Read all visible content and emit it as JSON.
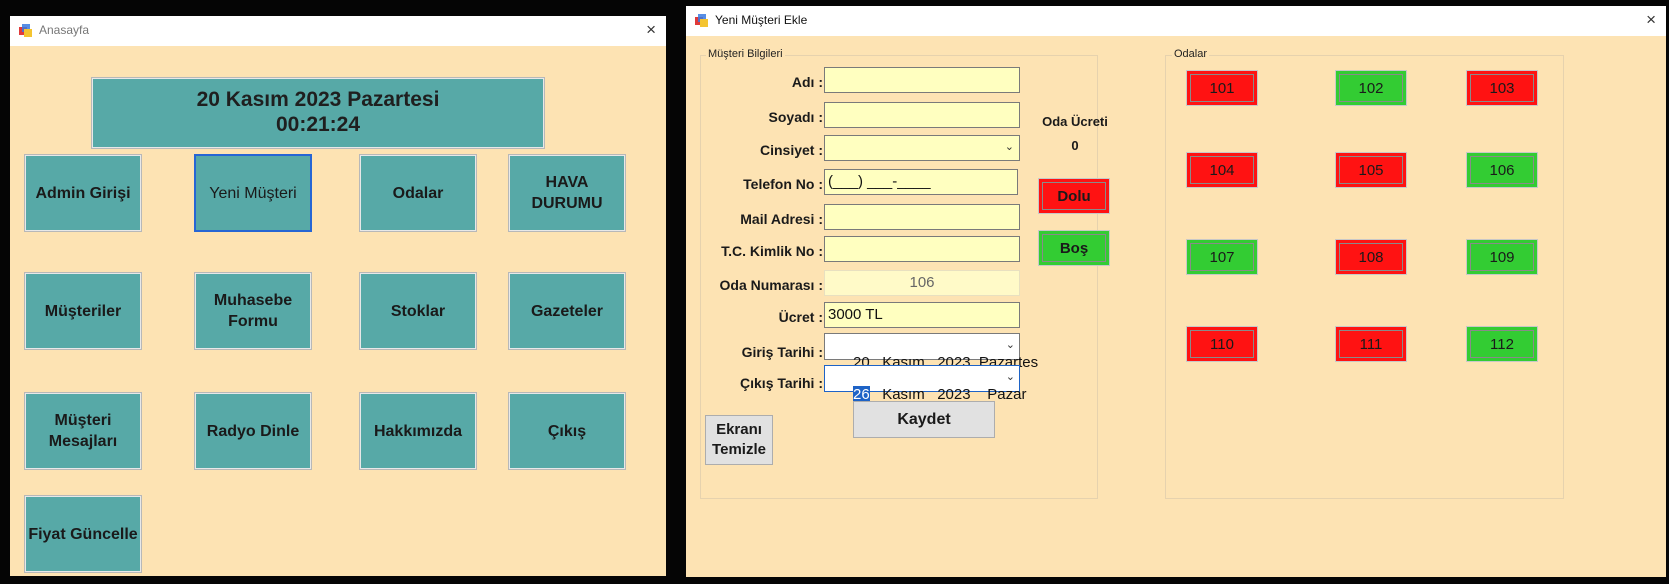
{
  "colors": {
    "background": "#fde3b3",
    "teal_button": "#57a9a7",
    "occupied": "#ff1212",
    "vacant": "#33cc33",
    "input_bg": "#ffffc0",
    "selection": "#1e63c6"
  },
  "main_window": {
    "title": "Anasayfa",
    "icon": "app-icon",
    "close_icon": "×",
    "date_line": "20 Kasım 2023 Pazartesi",
    "time_line": "00:21:24",
    "buttons": [
      "Admin Girişi",
      "Yeni Müşteri",
      "Odalar",
      "HAVA DURUMU",
      "Müşteriler",
      "Muhasebe Formu",
      "Stoklar",
      "Gazeteler",
      "Müşteri Mesajları",
      "Radyo Dinle",
      "Hakkımızda",
      "Çıkış",
      "Fiyat Güncelle"
    ]
  },
  "customer_window": {
    "title": "Yeni Müşteri Ekle",
    "icon": "app-icon",
    "close_icon": "×",
    "customer_group": {
      "title": "Müşteri Bilgileri",
      "fields": {
        "name": {
          "label": "Adı :",
          "value": ""
        },
        "surname": {
          "label": "Soyadı :",
          "value": ""
        },
        "gender": {
          "label": "Cinsiyet :",
          "value": ""
        },
        "phone": {
          "label": "Telefon No :",
          "value": "(___) ___-____"
        },
        "mail": {
          "label": "Mail Adresi :",
          "value": ""
        },
        "tc": {
          "label": "T.C. Kimlik No :",
          "value": ""
        },
        "room_no": {
          "label": "Oda Numarası :",
          "value": "106"
        },
        "price": {
          "label": "Ücret :",
          "value": "3000 TL"
        },
        "checkin": {
          "label": "Giriş Tarihi :",
          "value": "20   Kasım   2023  Pazartes"
        },
        "checkout": {
          "label": "Çıkış Tarihi :",
          "day": "26",
          "rest": "   Kasım   2023    Pazar"
        }
      },
      "save_button": "Kaydet",
      "clear_button": "Ekranı Temizle"
    },
    "room_fee": {
      "label": "Oda Ücreti",
      "value": "0"
    },
    "legend": {
      "occupied": "Dolu",
      "vacant": "Boş"
    },
    "rooms_group": {
      "title": "Odalar",
      "rooms": [
        {
          "number": "101",
          "status": "occupied"
        },
        {
          "number": "102",
          "status": "vacant"
        },
        {
          "number": "103",
          "status": "occupied"
        },
        {
          "number": "104",
          "status": "occupied"
        },
        {
          "number": "105",
          "status": "occupied"
        },
        {
          "number": "106",
          "status": "vacant"
        },
        {
          "number": "107",
          "status": "vacant"
        },
        {
          "number": "108",
          "status": "occupied"
        },
        {
          "number": "109",
          "status": "vacant"
        },
        {
          "number": "110",
          "status": "occupied"
        },
        {
          "number": "111",
          "status": "occupied"
        },
        {
          "number": "112",
          "status": "vacant"
        }
      ]
    }
  }
}
